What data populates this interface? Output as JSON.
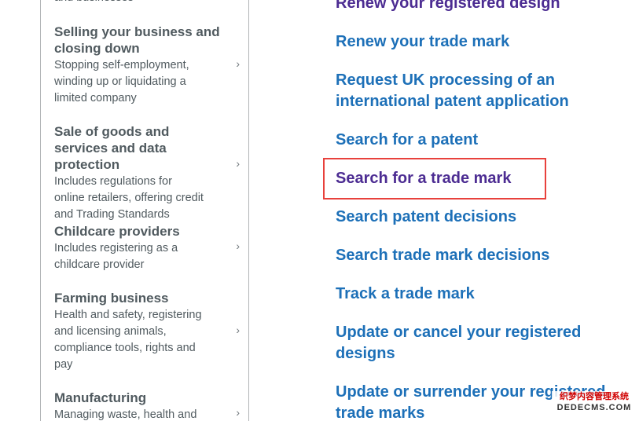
{
  "sidebar": {
    "cut_top_text": "and businesses",
    "items": [
      {
        "title": "Selling your business and closing down",
        "description": "Stopping self-employment, winding up or liquidating a limited company"
      },
      {
        "title": "Sale of goods and services and data protection",
        "description": "Includes regulations for online retailers, offering credit and Trading Standards"
      },
      {
        "title": "Childcare providers",
        "description": "Includes registering as a childcare provider"
      },
      {
        "title": "Farming business",
        "description": "Health and safety, registering and licensing animals, compliance tools, rights and pay"
      },
      {
        "title": "Manufacturing",
        "description": "Managing waste, health and"
      }
    ],
    "chevron": "›"
  },
  "links": [
    {
      "label": "Renew your registered design",
      "visited": true
    },
    {
      "label": "Renew your trade mark",
      "visited": false
    },
    {
      "label": "Request UK processing of an international patent application",
      "visited": false
    },
    {
      "label": "Search for a patent",
      "visited": false
    },
    {
      "label": "Search for a trade mark",
      "visited": true,
      "highlighted": true
    },
    {
      "label": "Search patent decisions",
      "visited": false
    },
    {
      "label": "Search trade mark decisions",
      "visited": false
    },
    {
      "label": "Track a trade mark",
      "visited": false
    },
    {
      "label": "Update or cancel your registered designs",
      "visited": false
    },
    {
      "label": "Update or surrender your registered trade marks",
      "visited": false
    }
  ],
  "highlight_color": "#e8413c",
  "link_color": "#1d70b8",
  "visited_link_color": "#4c2c92",
  "watermark": {
    "line1": "织梦内容管理系统",
    "line2": "DEDECMS.COM"
  }
}
